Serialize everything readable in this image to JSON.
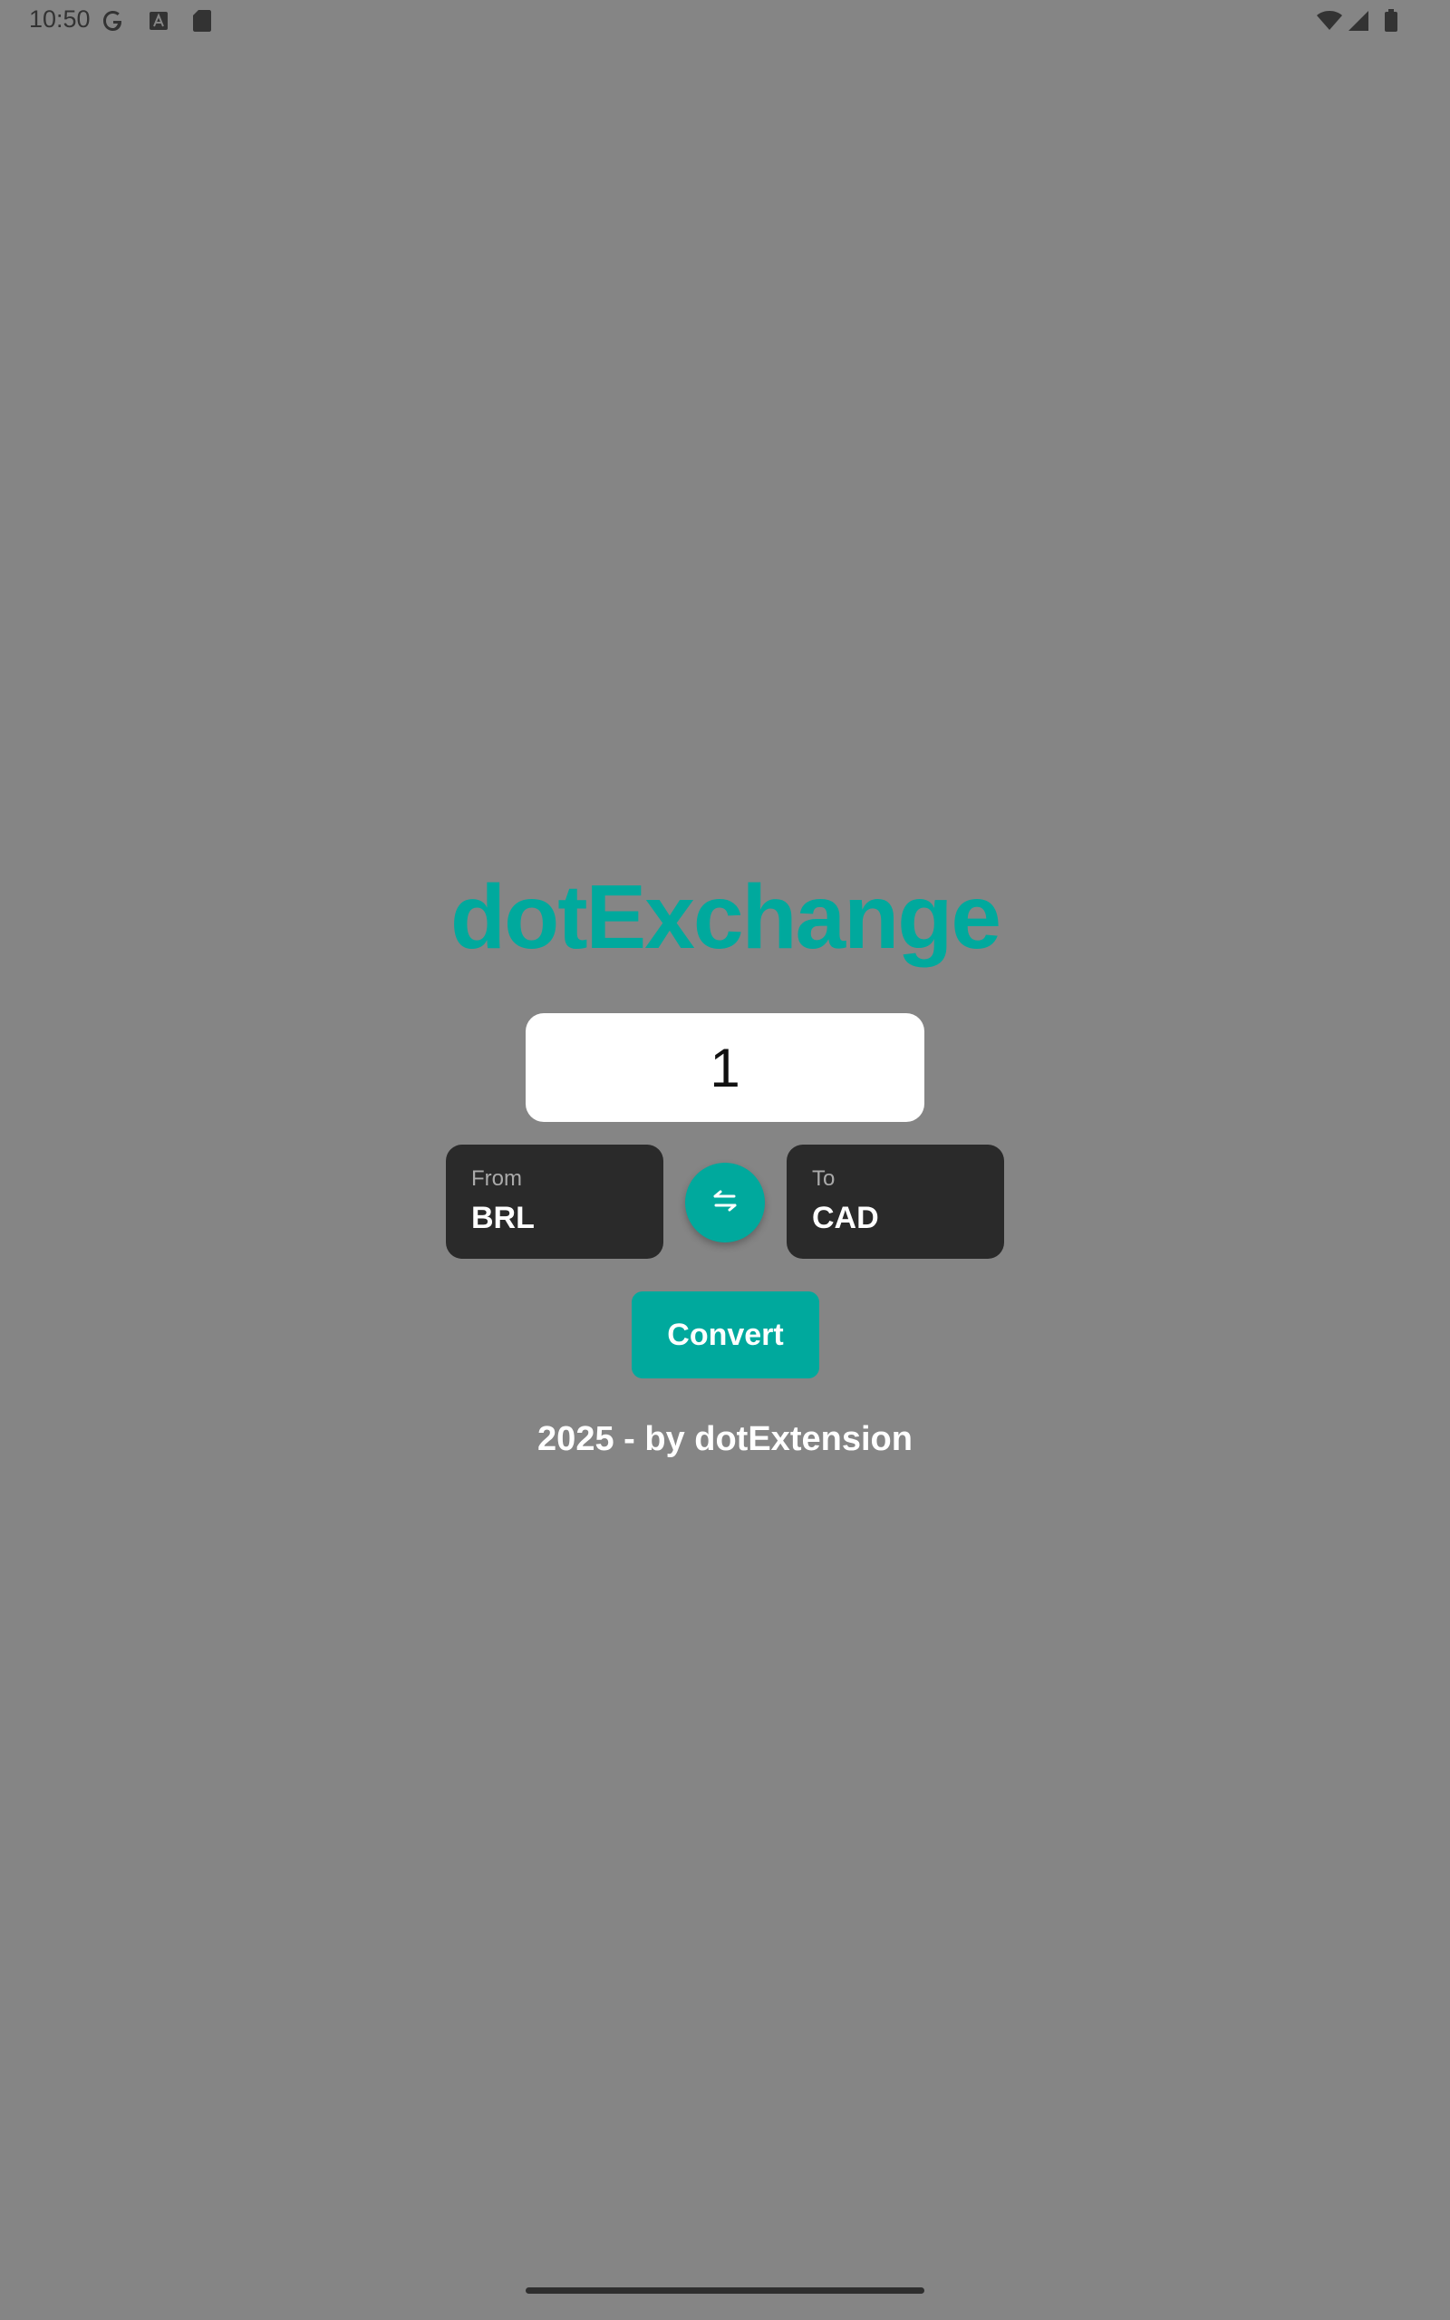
{
  "status_bar": {
    "time": "10:50",
    "left_icons": [
      "google-icon",
      "a-letter-icon",
      "sd-card-icon"
    ],
    "right_icons": [
      "wifi-icon",
      "cell-signal-icon",
      "battery-icon"
    ]
  },
  "app": {
    "title": "dotExchange",
    "amount_value": "1",
    "from": {
      "label": "From",
      "currency": "BRL"
    },
    "to": {
      "label": "To",
      "currency": "CAD"
    },
    "swap_icon": "swap-arrows-icon",
    "convert_label": "Convert",
    "footer": "2025 - by dotExtension"
  },
  "colors": {
    "background": "#858585",
    "accent": "#00a99d",
    "selector_bg": "#2a2a2a",
    "input_bg": "#ffffff"
  }
}
